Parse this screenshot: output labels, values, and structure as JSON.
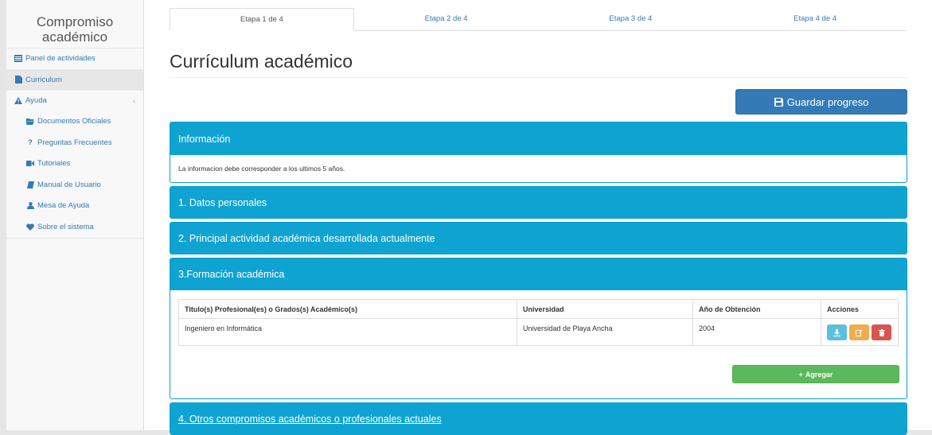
{
  "brand": {
    "line1": "Compromiso",
    "line2": "académico"
  },
  "sidebar": {
    "items": [
      {
        "label": "Panel de actividades",
        "icon": "dashboard-icon"
      },
      {
        "label": "Curriculum",
        "icon": "file-icon"
      },
      {
        "label": "Ayuda",
        "icon": "warning-icon"
      },
      {
        "label": "Documentos Oficiales",
        "icon": "folder-open-icon"
      },
      {
        "label": "Preguntas Frecuentes",
        "icon": "question-icon"
      },
      {
        "label": "Tutoriales",
        "icon": "video-camera-icon"
      },
      {
        "label": "Manual de Usuario",
        "icon": "book-icon"
      },
      {
        "label": "Mesa de Ayuda",
        "icon": "user-icon"
      },
      {
        "label": "Sobre el sistema",
        "icon": "heart-icon"
      }
    ]
  },
  "tabs": [
    "Etapa 1 de 4",
    "Etapa 2 de 4",
    "Etapa 3 de 4",
    "Etapa 4 de 4"
  ],
  "page_title": "Currículum académico",
  "save_label": "Guardar progreso",
  "panels": {
    "info_title": "Información",
    "info_text": "La informacion debe corresponder a los ultimos 5 años.",
    "p1": "1. Datos personales",
    "p2": "2. Principal actividad académica desarrollada actualmente",
    "p3": "3.Formación académica",
    "p4": "4. Otros compromisos académicos o profesionales actuales"
  },
  "table": {
    "headers": [
      "Titulo(s) Profesional(es) o Grados(s) Académico(s)",
      "Universidad",
      "Año de Obtención",
      "Acciones"
    ],
    "rows": [
      [
        "Ingeniero en Informática",
        "Universidad de Playa Ancha",
        "2004"
      ]
    ]
  },
  "add_label": "Agregar",
  "colors": {
    "primary": "#337ab7",
    "panel_head": "#0fa3d2",
    "info_btn": "#5bc0de",
    "warning_btn": "#f0ad4e",
    "danger_btn": "#d9534f",
    "success_btn": "#5cb85c"
  }
}
